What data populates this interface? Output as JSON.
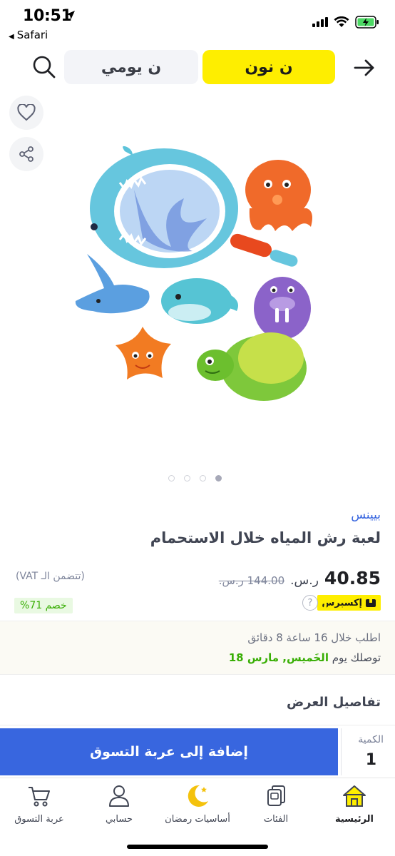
{
  "status_bar": {
    "time": "10:51",
    "back_app": "Safari"
  },
  "header": {
    "noon_tab": "ن نون",
    "yawmi_tab": "ن يومي"
  },
  "product": {
    "brand": "بيينس",
    "title": "لعبة رش المياه خلال الاستحمام",
    "price": "40.85",
    "currency": "ر.س.",
    "old_price": "144.00 ر.س.",
    "vat_note": "(تتضمن الـ VAT)",
    "express_label": "إكسبرس",
    "help_glyph": "?",
    "discount": "خصم 71%",
    "image_dots": 4,
    "active_dot": 0
  },
  "delivery": {
    "order_within": "اطلب خلال 16 ساعة 8 دقائق",
    "deliver_prefix": "توصلك يوم",
    "deliver_date": "الخَميس, مارس 18"
  },
  "section": {
    "offer_details": "تفاصيل العرض"
  },
  "cart_bar": {
    "add_to_cart": "إضافة إلى عربة التسوق",
    "quantity_label": "الكمية",
    "quantity_value": "1"
  },
  "bottom_nav": {
    "items": [
      {
        "label": "الرئيسية",
        "icon": "home-icon",
        "active": true
      },
      {
        "label": "الفئات",
        "icon": "categories-icon",
        "active": false
      },
      {
        "label": "أساسيات رمضان",
        "icon": "crescent-moon-icon",
        "active": false
      },
      {
        "label": "حسابي",
        "icon": "account-icon",
        "active": false
      },
      {
        "label": "عربة التسوق",
        "icon": "cart-icon",
        "active": false
      }
    ]
  },
  "colors": {
    "noon_yellow": "#feee00",
    "primary_blue": "#3866df",
    "success_green": "#38ae04"
  }
}
